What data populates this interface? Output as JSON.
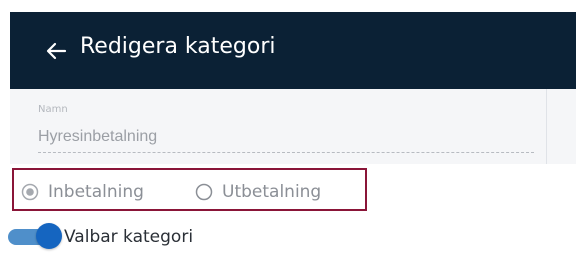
{
  "header": {
    "title": "Redigera kategori",
    "back_icon": "arrow-left-icon"
  },
  "form": {
    "name": {
      "label": "Namn",
      "value": "Hyresinbetalning"
    }
  },
  "radio": {
    "options": [
      {
        "label": "Inbetalning",
        "selected": true
      },
      {
        "label": "Utbetalning",
        "selected": false
      }
    ],
    "highlight_border_color": "#8a1538"
  },
  "toggle": {
    "label": "Valbar kategori",
    "on": true,
    "color": "#1565c0"
  },
  "colors": {
    "header_bg": "#0b2135",
    "panel_bg": "#f5f6f8"
  }
}
